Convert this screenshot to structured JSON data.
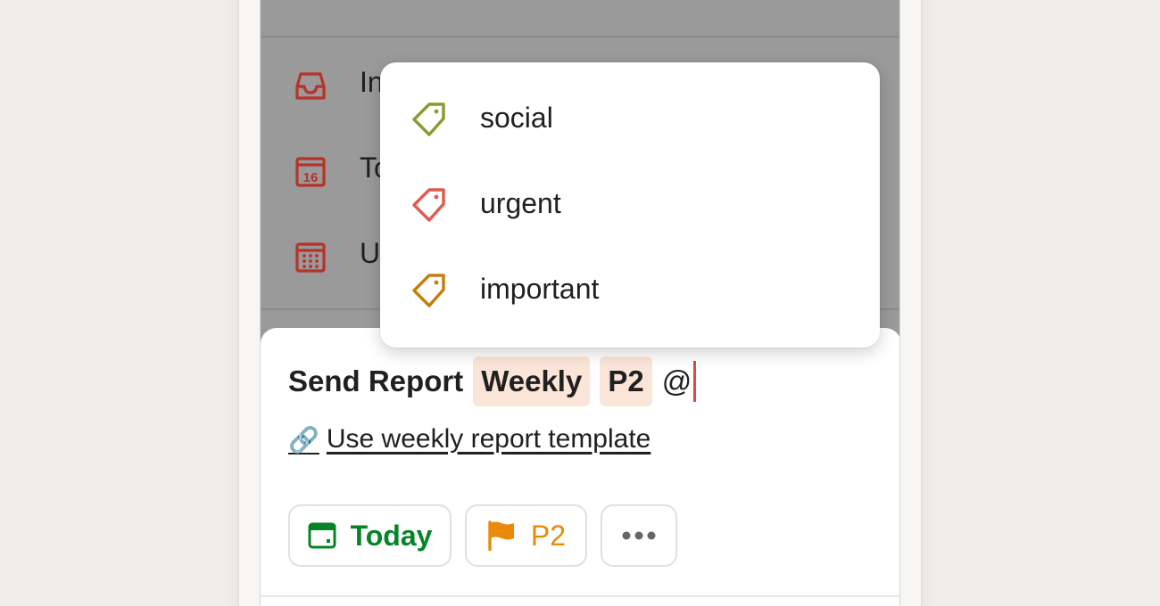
{
  "nav": {
    "items": [
      {
        "label": "Inbox",
        "icon": "inbox-icon"
      },
      {
        "label": "Today",
        "icon": "calendar-today-icon",
        "badge": "16"
      },
      {
        "label": "Upcoming",
        "icon": "calendar-upcoming-icon"
      }
    ],
    "accent_color": "#b8322a"
  },
  "label_popup": {
    "items": [
      {
        "label": "social",
        "color": "#8a9a2e"
      },
      {
        "label": "urgent",
        "color": "#e05a4f"
      },
      {
        "label": "important",
        "color": "#c77d0a"
      }
    ]
  },
  "composer": {
    "task_title": "Send Report",
    "chips": [
      "Weekly",
      "P2"
    ],
    "typed_text": "@",
    "template_link": "Use weekly report template",
    "buttons": {
      "date_label": "Today",
      "date_color": "#058527",
      "priority_label": "P2",
      "priority_color": "#eb8909",
      "more_icon": "more-horizontal-icon"
    }
  }
}
